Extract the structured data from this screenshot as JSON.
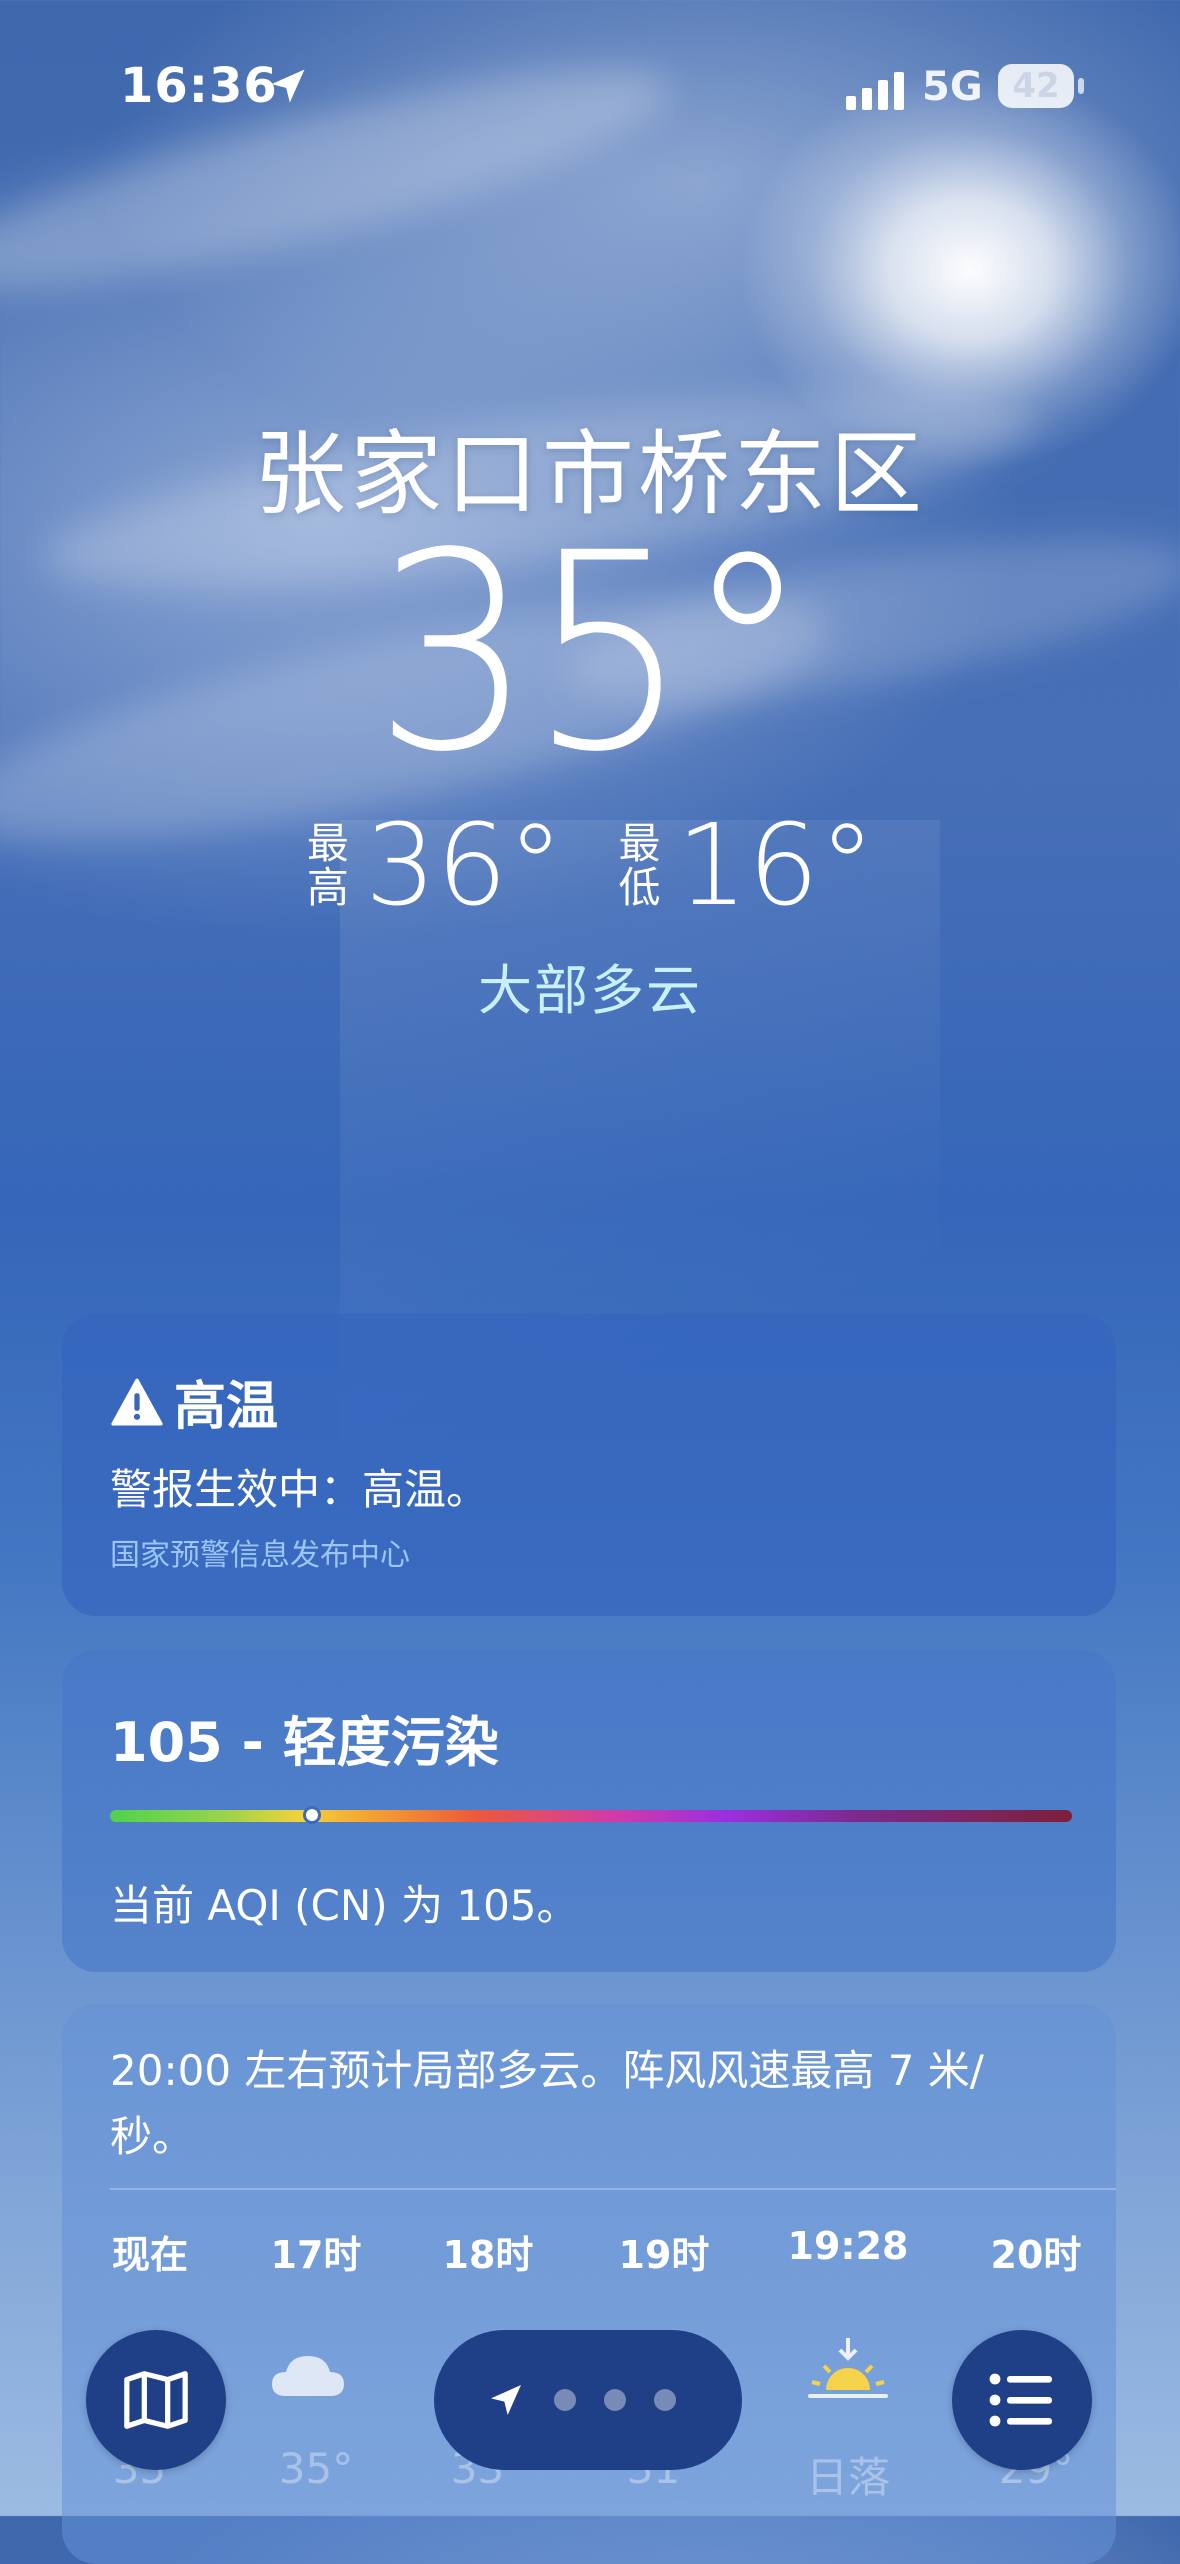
{
  "status_bar": {
    "time": "16:36",
    "network": "5G",
    "battery": "42"
  },
  "header": {
    "city": "张家口市桥东区",
    "temperature": "35°",
    "high_label": "最高",
    "high": "36°",
    "low_label": "最低",
    "low": "16°",
    "condition": "大部多云"
  },
  "alert": {
    "title": "高温",
    "body": "警报生效中：高温。",
    "source": "国家预警信息发布中心"
  },
  "aqi": {
    "title": "105 - 轻度污染",
    "text": "当前 AQI (CN) 为 105。",
    "value": 105,
    "marker_fraction": 0.21
  },
  "forecast": {
    "summary": "20:00 左右预计局部多云。阵风风速最高 7 米/秒。",
    "hours": [
      {
        "label": "现在",
        "icon": "sun-icon",
        "temp": "35°"
      },
      {
        "label": "17时",
        "icon": "cloud-icon",
        "temp": "35°"
      },
      {
        "label": "18时",
        "icon": "cloud-icon",
        "temp": "33°"
      },
      {
        "label": "19时",
        "icon": "cloud-icon",
        "temp": "31°"
      },
      {
        "label": "19:28",
        "icon": "sunset-icon",
        "temp": "日落"
      },
      {
        "label": "20时",
        "icon": "cloud-icon",
        "temp": "29°"
      }
    ]
  },
  "toolbar": {
    "map": "map-icon",
    "list": "list-icon",
    "pages": 3
  },
  "colors": {
    "condition_text": "#c9f0ff",
    "toolbar_button": "#1f3f86",
    "alert_source": "#9cc5f5"
  }
}
